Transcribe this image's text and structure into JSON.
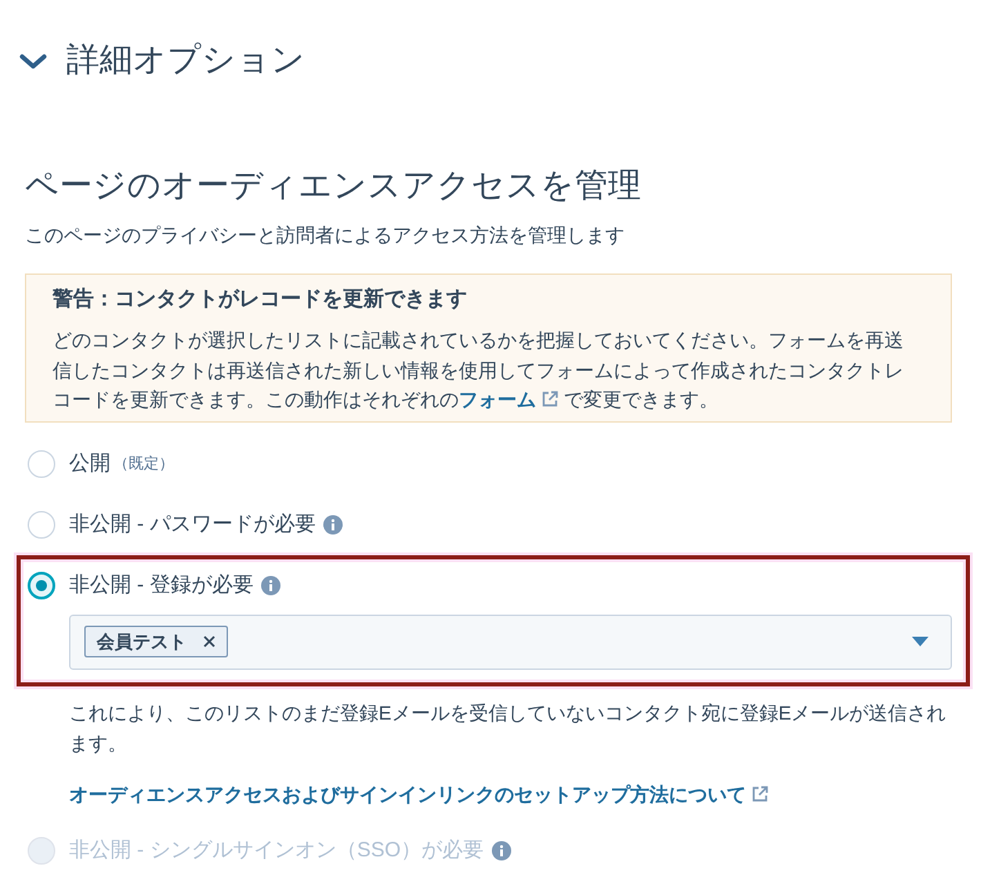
{
  "section": {
    "title": "詳細オプション",
    "expanded": true
  },
  "audience": {
    "title": "ページのオーディエンスアクセスを管理",
    "subtitle": "このページのプライバシーと訪問者によるアクセス方法を管理します"
  },
  "warning": {
    "title": "警告：コンタクトがレコードを更新できます",
    "body_parts": [
      {
        "kind": "text",
        "text": "どのコンタクトが選択したリストに記載されているかを把握しておいてください。フォームを再送信したコンタクトは再送信された新しい情報を使用してフォームによって作成されたコンタクトレコードを更新できます。この動作はそれぞれの"
      },
      {
        "kind": "link",
        "text": "フォーム"
      },
      {
        "kind": "text",
        "text": "で変更できます。"
      }
    ]
  },
  "options": [
    {
      "label": "公開",
      "note": "（既定）",
      "selected": false,
      "disabled": false,
      "info": false,
      "highlighted": false
    },
    {
      "label": "非公開 - パスワードが必要",
      "selected": false,
      "disabled": false,
      "info": true,
      "highlighted": false
    },
    {
      "label": "非公開 - 登録が必要",
      "selected": true,
      "disabled": false,
      "info": true,
      "highlighted": true,
      "tags": [
        {
          "label": "会員テスト"
        }
      ],
      "description": "これにより、このリストのまだ登録Eメールを受信していないコンタクト宛に登録Eメールが送信されます。",
      "help_link": "オーディエンスアクセスおよびサインインリンクのセットアップ方法について"
    },
    {
      "label": "非公開 - シングルサインオン（SSO）が必要",
      "selected": false,
      "disabled": true,
      "info": true,
      "highlighted": false
    }
  ]
}
